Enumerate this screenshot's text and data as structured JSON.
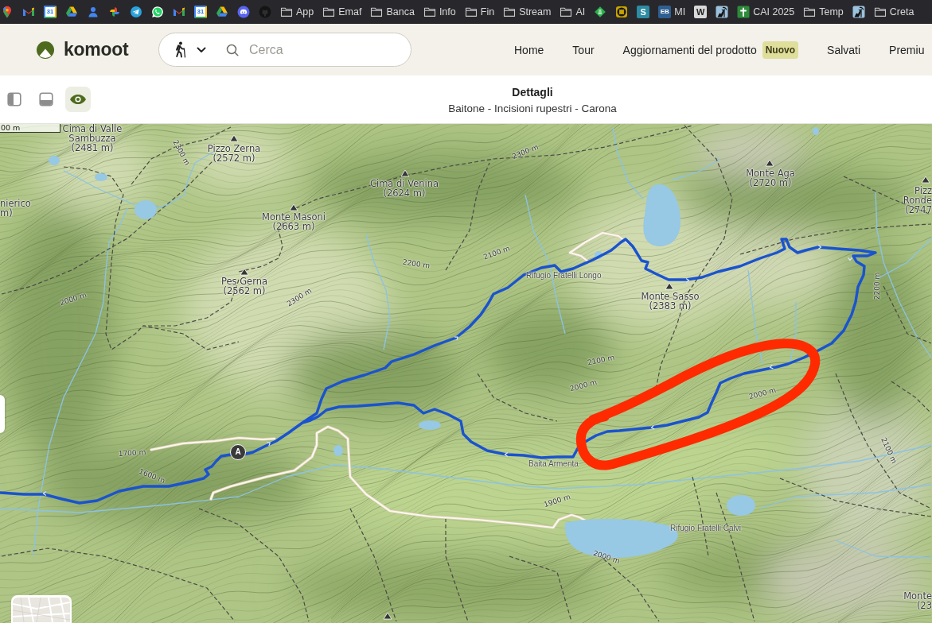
{
  "bookmarks": [
    {
      "kind": "pin"
    },
    {
      "kind": "mail"
    },
    {
      "kind": "calendar",
      "glyph": "31"
    },
    {
      "kind": "drive"
    },
    {
      "kind": "person"
    },
    {
      "kind": "pinwheel"
    },
    {
      "kind": "telegram"
    },
    {
      "kind": "whatsapp"
    },
    {
      "kind": "mail"
    },
    {
      "kind": "calendar",
      "glyph": "31"
    },
    {
      "kind": "drive"
    },
    {
      "kind": "discord"
    },
    {
      "kind": "github"
    },
    {
      "kind": "folder",
      "label": "App"
    },
    {
      "kind": "folder",
      "label": "Emaf"
    },
    {
      "kind": "folder",
      "label": "Banca"
    },
    {
      "kind": "folder",
      "label": "Info"
    },
    {
      "kind": "folder",
      "label": "Fin"
    },
    {
      "kind": "folder",
      "label": "Stream"
    },
    {
      "kind": "folder",
      "label": "AI"
    },
    {
      "kind": "leaf"
    },
    {
      "kind": "lifebuoy"
    },
    {
      "kind": "letter",
      "glyph": "S",
      "color": "#2d8ba3"
    },
    {
      "kind": "letter",
      "glyph": "EB",
      "color": "#2f5f91",
      "label": "MI"
    },
    {
      "kind": "letter",
      "glyph": "W",
      "color": "#d9d9d9"
    },
    {
      "kind": "reader"
    },
    {
      "kind": "cross",
      "label": "CAI 2025"
    },
    {
      "kind": "folder",
      "label": "Temp"
    },
    {
      "kind": "reader"
    },
    {
      "kind": "folder",
      "label": "Creta"
    }
  ],
  "header": {
    "logo": "komoot",
    "search": {
      "placeholder": "Cerca"
    },
    "nav": [
      {
        "label": "Home"
      },
      {
        "label": "Tour"
      },
      {
        "label": "Aggiornamenti del prodotto",
        "badge": "Nuovo"
      },
      {
        "label": "Salvati"
      },
      {
        "label": "Premiu"
      }
    ]
  },
  "view_buttons": [
    {
      "kind": "sidebar",
      "selected": false
    },
    {
      "kind": "bottom",
      "selected": false
    },
    {
      "kind": "map",
      "selected": true
    }
  ],
  "panel": {
    "title": "Dettagli",
    "subtitle": "Baitone - Incisioni rupestri - Carona"
  },
  "map": {
    "scale": "00 m",
    "start_marker": "A",
    "peaks": [
      {
        "name": "Cima di Valle Sambuzza",
        "elevation": "(2481 m)"
      },
      {
        "name": "Pizzo Zerna",
        "elevation": "(2572 m)"
      },
      {
        "name": "Cima di Venina",
        "elevation": "(2624 m)"
      },
      {
        "name": "Monte Aga",
        "elevation": "(2720 m)"
      },
      {
        "name": "nierico",
        "elevation": "m)"
      },
      {
        "name": "Monte Masoni",
        "elevation": "(2663 m)"
      },
      {
        "name": "Pizz Ronde",
        "elevation": "(2747"
      },
      {
        "name": "Pes Gerna",
        "elevation": "(2562 m)"
      },
      {
        "name": "Monte Sasso",
        "elevation": "(2383 m)"
      },
      {
        "name": "Monte",
        "elevation": "(23"
      }
    ],
    "places": [
      "Rifugio Fratelli Longo",
      "Baita Armenta",
      "Rifugio Fratelli Calvi"
    ],
    "elevation_labels": [
      "2300 m",
      "2300 m",
      "2200 m",
      "2100 m",
      "2000 m",
      "2300 m",
      "2200 m",
      "2100 m",
      "2000 m",
      "2000 m",
      "1700 m",
      "2100 m",
      "1600 m",
      "1900 m",
      "2000 m"
    ]
  }
}
